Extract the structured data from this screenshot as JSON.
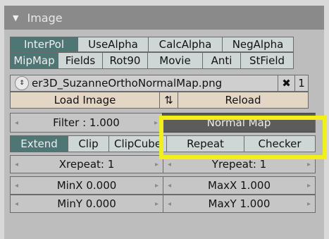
{
  "panel": {
    "title": "Image",
    "collapse_glyph": "▼"
  },
  "row1": [
    "InterPol",
    "UseAlpha",
    "CalcAlpha",
    "NegAlpha"
  ],
  "row2": [
    "MipMap",
    "Fields",
    "Rot90",
    "Movie",
    "Anti",
    "StField"
  ],
  "file": {
    "selector_glyph": "⇕",
    "filename": "er3D_SuzanneOrthoNormalMap.png",
    "clear_glyph": "✖",
    "users": "1"
  },
  "load": {
    "load_label": "Load Image",
    "reload_label": "Reload",
    "pack_glyph": "⇅"
  },
  "filter": {
    "label": "Filter : 1.000",
    "normal_map_label": "Normal Map"
  },
  "extend_row": [
    "Extend",
    "Clip",
    "ClipCube",
    "Repeat",
    "Checker"
  ],
  "repeat": {
    "x": "Xrepeat: 1",
    "y": "Yrepeat: 1"
  },
  "min": {
    "x": "MinX 0.000",
    "y": "MinY 0.000"
  },
  "max": {
    "x": "MaxX 1.000",
    "y": "MaxY 1.000"
  },
  "arrows": {
    "left": "◂",
    "right": "▸"
  },
  "colors": {
    "accent_on": "#4e7674",
    "highlight": "#f2ef1c",
    "header": "#8a8a8a"
  }
}
